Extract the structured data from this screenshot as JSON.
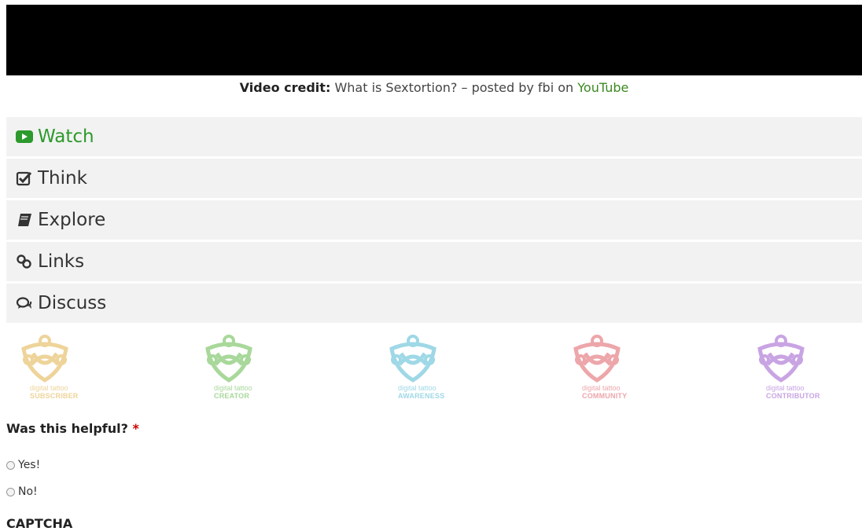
{
  "video_credit": {
    "label": "Video credit:",
    "text": "What is Sextortion? – posted by fbi on",
    "link": "YouTube"
  },
  "tabs": [
    {
      "label": "Watch",
      "icon": "play-icon",
      "active": true
    },
    {
      "label": "Think",
      "icon": "checkbox-icon",
      "active": false
    },
    {
      "label": "Explore",
      "icon": "book-icon",
      "active": false
    },
    {
      "label": "Links",
      "icon": "link-icon",
      "active": false
    },
    {
      "label": "Discuss",
      "icon": "comments-icon",
      "active": false
    }
  ],
  "badges": [
    {
      "line1": "digital tattoo",
      "line2": "SUBSCRIBER",
      "color": "#eed49a"
    },
    {
      "line1": "digital tattoo",
      "line2": "CREATOR",
      "color": "#a8d89a"
    },
    {
      "line1": "digital tattoo",
      "line2": "AWARENESS",
      "color": "#9fd8e6"
    },
    {
      "line1": "digital tattoo",
      "line2": "COMMUNITY",
      "color": "#eda6aa"
    },
    {
      "line1": "digital tattoo",
      "line2": "CONTRIBUTOR",
      "color": "#c9a4e3"
    }
  ],
  "question": {
    "label": "Was this helpful?",
    "required_mark": "*"
  },
  "options": [
    {
      "label": "Yes!"
    },
    {
      "label": "No!"
    }
  ],
  "captcha": {
    "label": "CAPTCHA"
  },
  "colors": {
    "accent": "#2c9a2c",
    "tab_bg": "#f2f2f2",
    "link": "#3a8a20"
  }
}
